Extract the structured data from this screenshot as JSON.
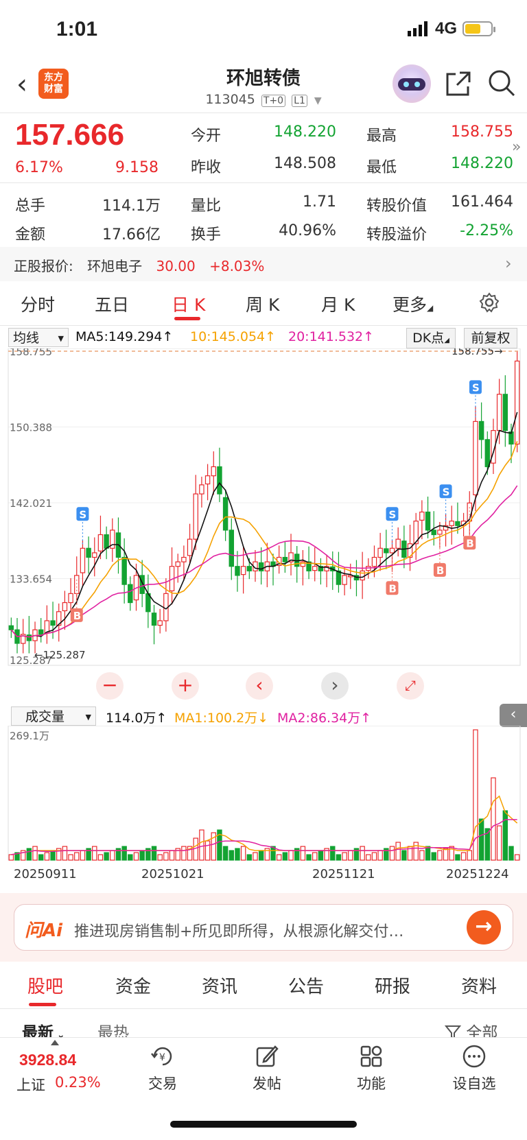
{
  "status": {
    "time": "1:01",
    "network": "4G"
  },
  "header": {
    "logo_text": "东方财富",
    "title": "环旭转债",
    "code": "113045",
    "tag1": "T+0",
    "tag2": "L1"
  },
  "quote": {
    "price": "157.666",
    "pct": "6.17%",
    "change": "9.158",
    "open_label": "今开",
    "open": "148.220",
    "high_label": "最高",
    "high": "158.755",
    "prev_label": "昨收",
    "prev": "148.508",
    "low_label": "最低",
    "low": "148.220",
    "vol_label": "总手",
    "vol": "114.1万",
    "ratio_label": "量比",
    "ratio": "1.71",
    "conv_label": "转股价值",
    "conv": "161.464",
    "amt_label": "金额",
    "amt": "17.66亿",
    "turn_label": "换手",
    "turn": "40.96%",
    "prem_label": "转股溢价",
    "prem": "-2.25%"
  },
  "stock": {
    "label": "正股报价:",
    "name": "环旭电子",
    "price": "30.00",
    "pct": "+8.03%"
  },
  "ktabs": [
    "分时",
    "五日",
    "日 K",
    "周 K",
    "月 K",
    "更多"
  ],
  "chart_header": {
    "selector": "均线",
    "ma5": "MA5:149.294↑",
    "ma10": "10:145.054↑",
    "ma20": "20:141.532↑",
    "dk": "DK点",
    "fq": "前复权"
  },
  "price_axis": {
    "p1": "158.755",
    "p2": "150.388",
    "p3": "142.021",
    "p4": "133.654",
    "p5": "125.287",
    "max_label": "158.755→",
    "min_label": "←125.287"
  },
  "vol_header": {
    "selector": "成交量",
    "vol": "114.0万↑",
    "ma1": "MA1:100.2万↓",
    "ma2": "MA2:86.34万↑",
    "max": "269.1万"
  },
  "dates": [
    "20250911",
    "20251021",
    "20251121",
    "20251224"
  ],
  "colors": {
    "up": "#e8282b",
    "down": "#13a332",
    "ma5": "#111111",
    "ma10": "#f5a100",
    "ma20": "#e020a0",
    "accent": "#f25c1e"
  },
  "ai": {
    "logo": "问Ai",
    "text": "推进现房销售制+所见即所得，从根源化解交付…"
  },
  "btabs": [
    "股吧",
    "资金",
    "资讯",
    "公告",
    "研报",
    "资料"
  ],
  "sort": {
    "latest": "最新",
    "hot": "最热",
    "all": "全部"
  },
  "bottom": {
    "index_value": "3928.84",
    "index_name": "上证",
    "index_pct": "0.23%",
    "nav": [
      "交易",
      "发帖",
      "功能",
      "设自选"
    ]
  },
  "chart_data": {
    "type": "candlestick",
    "title": "环旭转债 日K",
    "ylim": [
      125.287,
      158.755
    ],
    "x": [
      "20250911",
      "20251021",
      "20251121",
      "20251224"
    ],
    "series": [
      {
        "name": "MA5",
        "values": [
          149.294
        ]
      },
      {
        "name": "MA10",
        "values": [
          145.054
        ]
      },
      {
        "name": "MA20",
        "values": [
          141.532
        ]
      }
    ],
    "volume_max": "269.1万",
    "markers": [
      "S",
      "B",
      "S",
      "B",
      "S",
      "B",
      "S",
      "B"
    ]
  }
}
